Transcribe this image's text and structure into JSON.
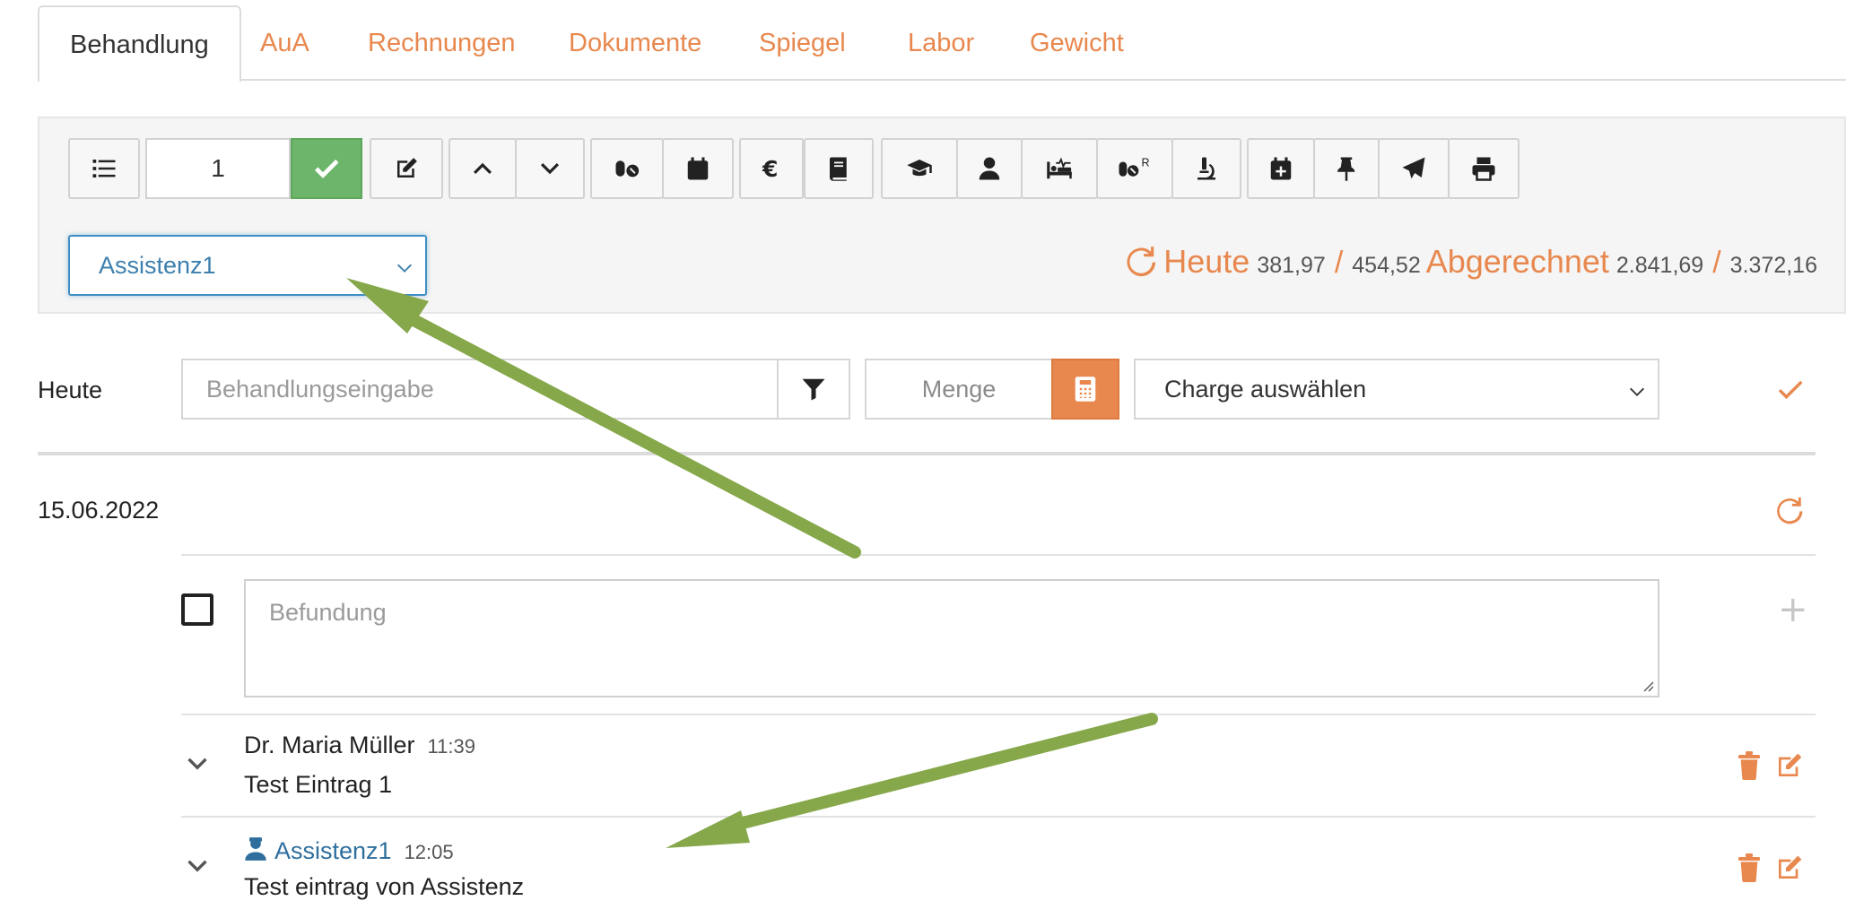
{
  "tabs": [
    {
      "label": "Behandlung",
      "active": true
    },
    {
      "label": "AuA"
    },
    {
      "label": "Rechnungen"
    },
    {
      "label": "Dokumente"
    },
    {
      "label": "Spiegel"
    },
    {
      "label": "Labor"
    },
    {
      "label": "Gewicht"
    }
  ],
  "toolbar": {
    "counter_value": "1",
    "small_text_r": "R",
    "icons": [
      "list-icon",
      "check-icon",
      "edit-icon",
      "chevron-up-icon",
      "chevron-down-icon",
      "pills-icon",
      "calendar-icon",
      "euro-icon",
      "book-icon",
      "graduation-cap-icon",
      "user-icon",
      "bed-pulse-icon",
      "pills-prescription-icon",
      "microscope-icon",
      "calendar-plus-icon",
      "thumbtack-icon",
      "paper-plane-icon",
      "print-icon"
    ]
  },
  "assistant_select": {
    "value": "Assistenz1"
  },
  "totals": {
    "heute_label": "Heute",
    "heute_value": "381,97",
    "slash": "/",
    "heute_total": "454,52",
    "abgerechnet_label": "Abgerechnet",
    "abgerechnet_value": "2.841,69",
    "abgerechnet_total": "3.372,16"
  },
  "entry_form": {
    "date_label": "Heute",
    "treatment_placeholder": "Behandlungseingabe",
    "amount_placeholder": "Menge",
    "batch_select": "Charge auswählen"
  },
  "day": {
    "date": "15.06.2022",
    "finding_placeholder": "Befundung",
    "entries": [
      {
        "author": "Dr. Maria Müller",
        "time": "11:39",
        "text": "Test Eintrag 1",
        "assistant": false
      },
      {
        "author": "Assistenz1",
        "time": "12:05",
        "text": "Test eintrag von Assistenz",
        "assistant": true
      }
    ]
  },
  "colors": {
    "accent": "#e8884e",
    "success": "#6cb56b",
    "link": "#2f6f9e",
    "annotation_arrow": "#86a84a"
  }
}
